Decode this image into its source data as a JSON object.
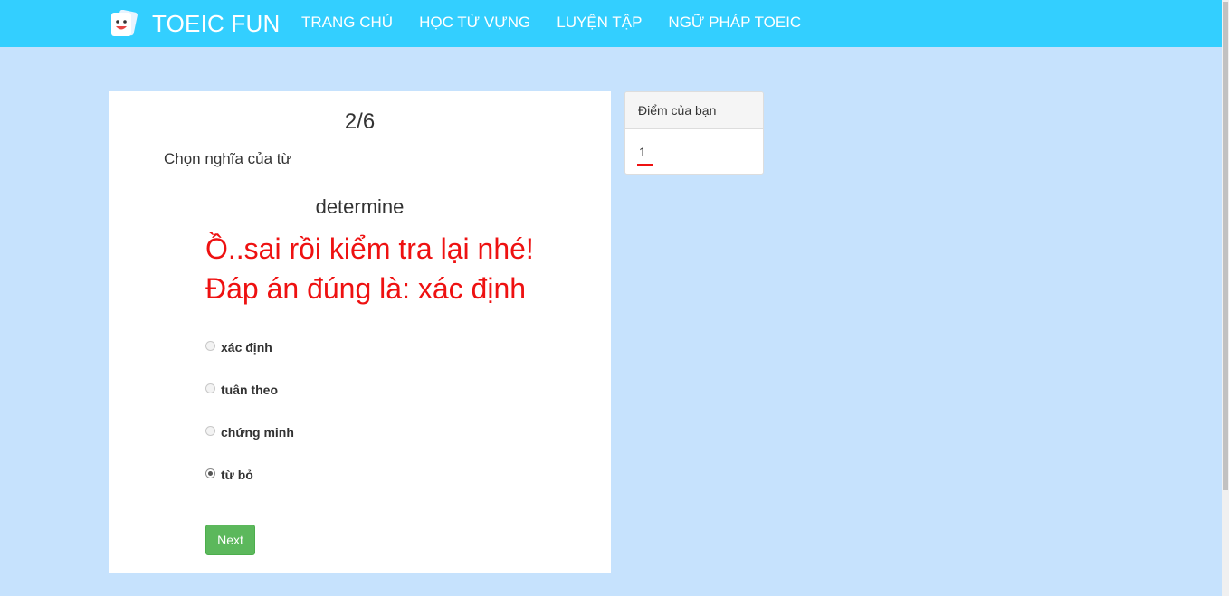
{
  "navbar": {
    "brand": "TOEIC FUN",
    "logo_icon": "smiley-card-icon",
    "links": [
      "TRANG CHỦ",
      "HỌC TỪ VỰNG",
      "LUYỆN TẬP",
      "NGỮ PHÁP TOEIC"
    ],
    "color": "#33cfff"
  },
  "quiz": {
    "progress": "2/6",
    "instruction": "Chọn nghĩa của từ",
    "word": "determine",
    "feedback_line1": "Ồ..sai rồi kiểm tra lại nhé!",
    "feedback_line2": "Đáp án đúng là: xác định",
    "feedback_color": "#ee1111",
    "options": [
      {
        "label": "xác định",
        "selected": false
      },
      {
        "label": "tuân theo",
        "selected": false
      },
      {
        "label": "chứng minh",
        "selected": false
      },
      {
        "label": "từ bỏ",
        "selected": true
      }
    ],
    "next_label": "Next",
    "next_color": "#5cb85c"
  },
  "score": {
    "heading": "Điểm của bạn",
    "value": "1"
  },
  "colors": {
    "page_background": "#c6e2fd"
  }
}
